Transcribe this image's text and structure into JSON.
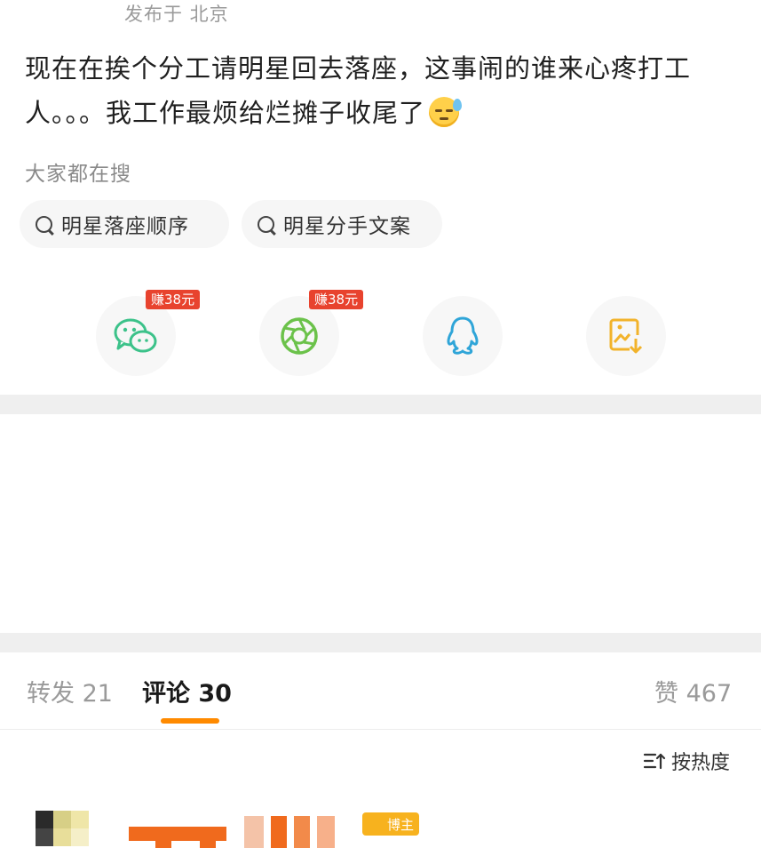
{
  "post": {
    "location": "发布于 北京",
    "text": "现在在挨个分工请明星回去落座，这事闹的谁来心疼打工人。。。我工作最烦给烂摊子收尾了"
  },
  "search": {
    "title": "大家都在搜",
    "chips": [
      "明星落座顺序",
      "明星分手文案"
    ]
  },
  "share": {
    "badge": "赚38元",
    "icons": [
      "wechat-icon",
      "moments-icon",
      "qq-icon",
      "save-image-icon"
    ]
  },
  "tabs": {
    "repost": "转发 21",
    "comment": "评论 30",
    "like": "赞 467"
  },
  "sort": {
    "label": "按热度"
  },
  "comment": {
    "owner_badge": "博主"
  },
  "colors": {
    "accent": "#ff8a00",
    "badge": "#e8432e",
    "wechat": "#3cc28a",
    "moments": "#6bc24a",
    "qq": "#2fa5d8",
    "save": "#f2b32b"
  }
}
